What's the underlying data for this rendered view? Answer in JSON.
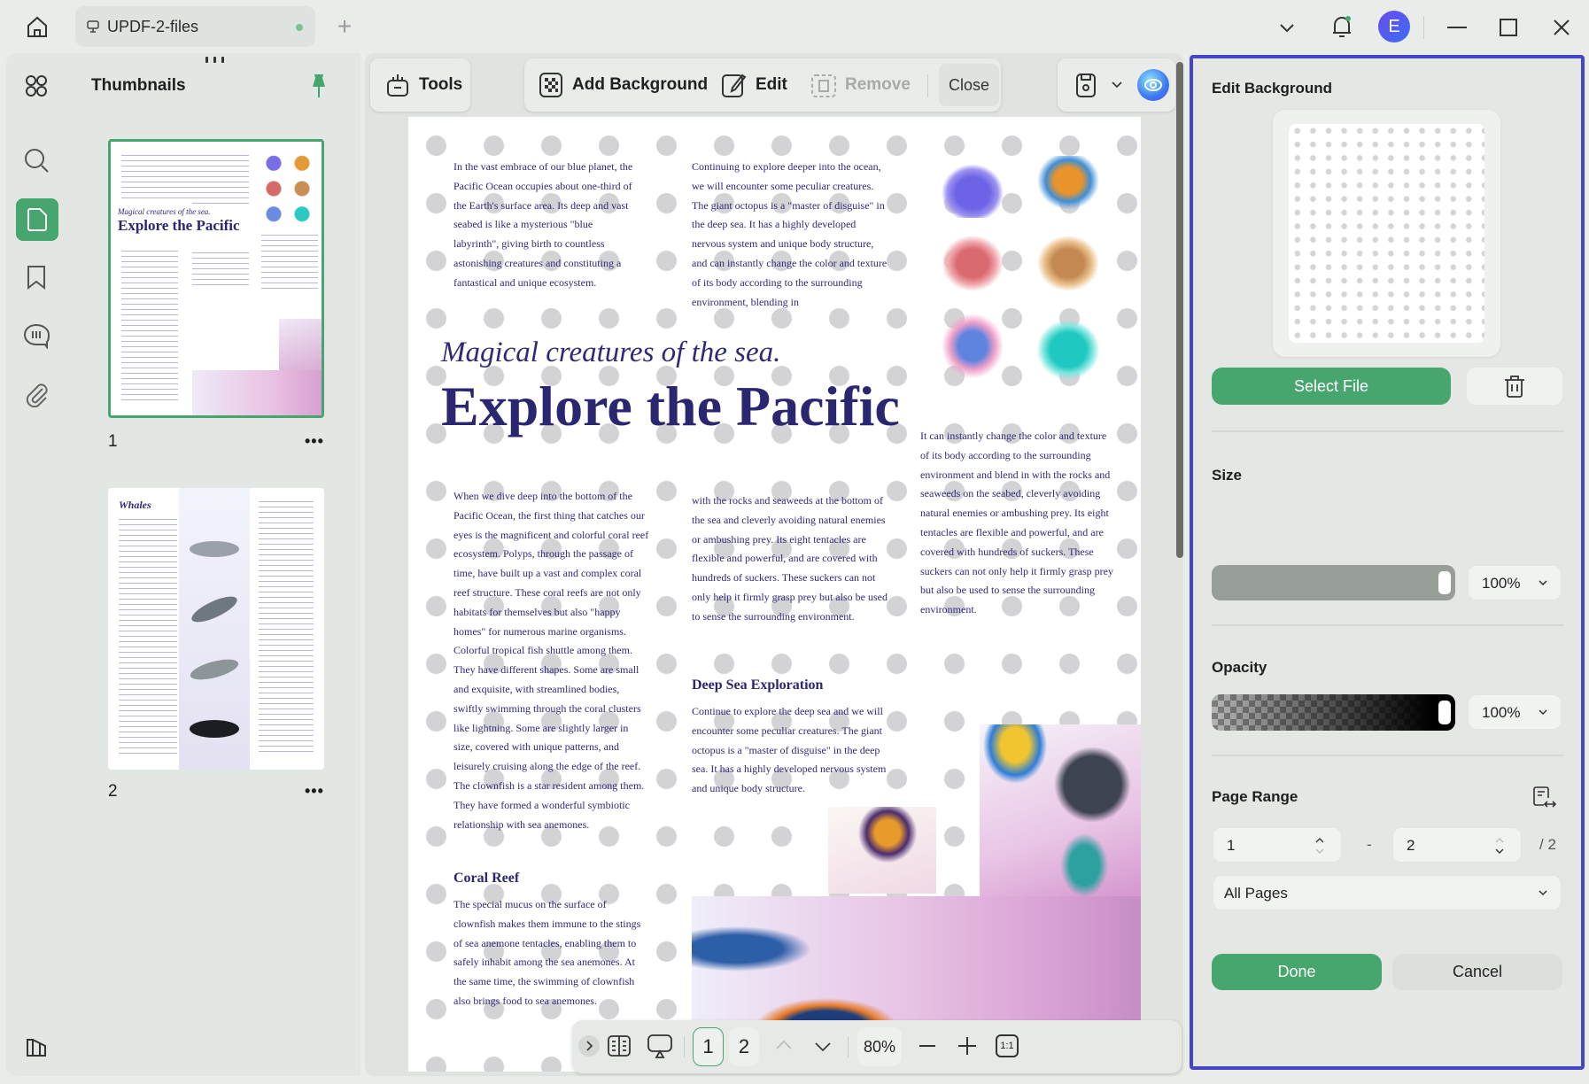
{
  "window": {
    "tab_title": "UPDF-2-files",
    "avatar_initial": "E"
  },
  "thumbnails": {
    "title": "Thumbnails",
    "pages": [
      {
        "label": "1"
      },
      {
        "label": "2"
      }
    ],
    "page2_heading": "Whales"
  },
  "toolbar": {
    "tools": "Tools",
    "add_background": "Add Background",
    "edit": "Edit",
    "remove": "Remove",
    "close": "Close"
  },
  "document": {
    "intro_left": "In the vast embrace of our blue planet, the Pacific Ocean occupies about one-third of the Earth's surface area. Its deep and vast seabed is like a mysterious \"blue labyrinth\", giving birth to countless astonishing creatures and constituting a fantastical and unique ecosystem.",
    "intro_right": "Continuing to explore deeper into the ocean, we will encounter some peculiar creatures. The giant octopus is a \"master of disguise\" in the deep sea. It has a highly developed nervous system and unique body structure, and can instantly change the color and texture of its body according to the surrounding environment, blending in",
    "subtitle": "Magical creatures of the sea.",
    "title": "Explore the Pacific",
    "col3": "It can instantly change the color and texture of its body according to the surrounding environment and blend in with the rocks and seaweeds on the seabed, cleverly avoiding natural enemies or ambushing prey. Its eight tentacles are flexible and powerful, and are covered with hundreds of suckers. These suckers can not only help it firmly grasp prey but also be used to sense the surrounding environment.",
    "col1": "When we dive deep into the bottom of the Pacific Ocean, the first thing that catches our eyes is the magnificent and colorful coral reef ecosystem. Polyps, through the passage of time, have built up a vast and complex coral reef structure. These coral reefs are not only habitats for themselves but also \"happy homes\" for numerous marine organisms. Colorful tropical fish shuttle among them. They have different shapes. Some are small and exquisite, with streamlined bodies, swiftly swimming through the coral clusters like lightning. Some are slightly larger in size, covered with unique patterns, and leisurely cruising along the edge of the reef. The clownfish is a star resident among them. They have formed a wonderful symbiotic relationship with sea anemones.",
    "col2": "with the rocks and seaweeds at the bottom of the sea and cleverly avoiding natural enemies or ambushing prey. Its eight tentacles are flexible and powerful, and are covered with hundreds of suckers. These suckers can not only help it firmly grasp prey but also be used to sense the surrounding environment.",
    "deep_sea_heading": "Deep Sea Exploration",
    "deep_sea_text": "Continue to explore the deep sea and we will encounter some peculiar creatures. The giant octopus is a \"master of disguise\" in the deep sea. It has a highly developed nervous system and unique body structure.",
    "coral_heading": "Coral Reef",
    "coral_text": "The special mucus on the surface of clownfish makes them immune to the stings of sea anemone tentacles, enabling them to safely inhabit among the sea anemones. At the same time, the swimming of clownfish also brings food to sea anemones."
  },
  "bottom_nav": {
    "page1": "1",
    "page2": "2",
    "zoom": "80%",
    "actual_size": "1:1"
  },
  "panel": {
    "title": "Edit Background",
    "select_file": "Select File",
    "size_label": "Size",
    "size_value": "100%",
    "size_fraction": 1.0,
    "opacity_label": "Opacity",
    "opacity_value": "100%",
    "opacity_fraction": 1.0,
    "page_range_label": "Page Range",
    "range_from": "1",
    "range_dash": "-",
    "range_to": "2",
    "range_total": "/ 2",
    "page_subset": "All Pages",
    "done": "Done",
    "cancel": "Cancel"
  },
  "colors": {
    "accent": "#47a56e",
    "highlight": "#4346c8",
    "doc_text": "#2e2a78"
  }
}
